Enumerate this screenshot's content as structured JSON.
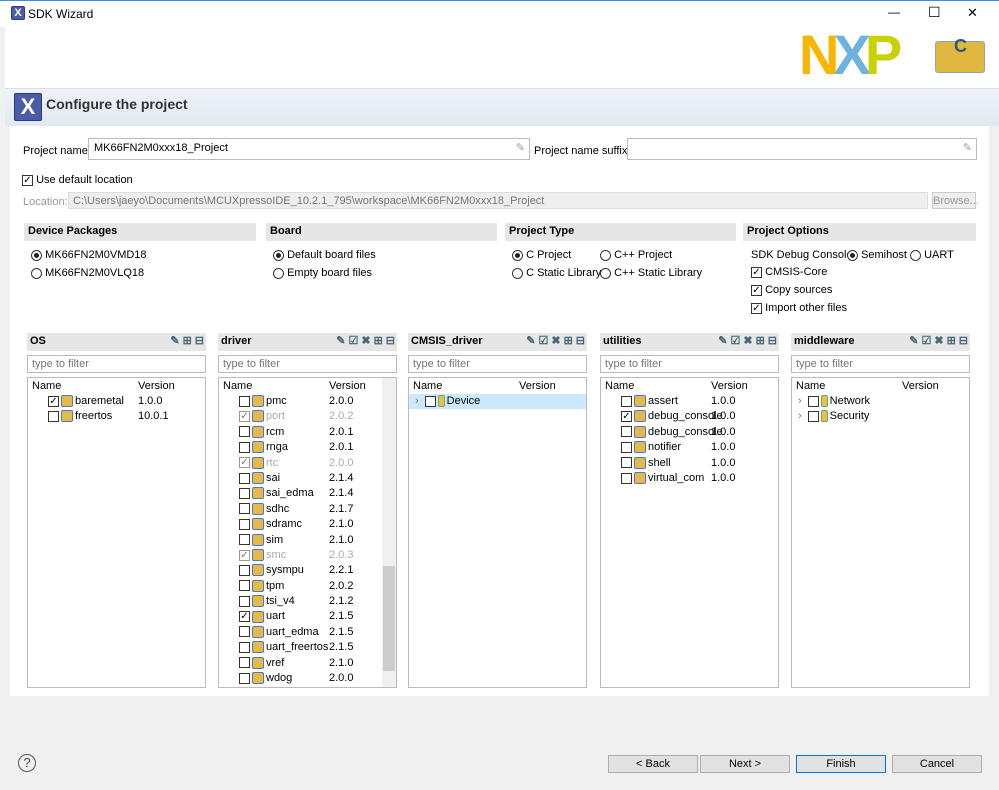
{
  "window": {
    "title": "SDK Wizard",
    "minimize": "—",
    "maximize": "☐",
    "close": "✕"
  },
  "banner": {
    "heading": "Configure the project",
    "logo": "NXP"
  },
  "project": {
    "name_label": "Project name:",
    "name_value": "MK66FN2M0xxx18_Project",
    "suffix_label": "Project name suffix:",
    "suffix_value": "",
    "use_default_label": "Use default location",
    "use_default_checked": true,
    "location_label": "Location:",
    "location_value": "C:\\Users\\jaeyo\\Documents\\MCUXpressoIDE_10.2.1_795\\workspace\\MK66FN2M0xxx18_Project",
    "browse_label": "Browse..."
  },
  "device_packages": {
    "title": "Device Packages",
    "options": [
      {
        "label": "MK66FN2M0VMD18",
        "selected": true
      },
      {
        "label": "MK66FN2M0VLQ18",
        "selected": false
      }
    ]
  },
  "board": {
    "title": "Board",
    "options": [
      {
        "label": "Default board files",
        "selected": true
      },
      {
        "label": "Empty board files",
        "selected": false
      }
    ]
  },
  "project_type": {
    "title": "Project Type",
    "options": [
      {
        "label": "C Project",
        "selected": true
      },
      {
        "label": "C++ Project",
        "selected": false
      },
      {
        "label": "C Static Library",
        "selected": false
      },
      {
        "label": "C++ Static Library",
        "selected": false
      }
    ]
  },
  "project_options": {
    "title": "Project Options",
    "debug_console_label": "SDK Debug Console",
    "semihost": "Semihost",
    "uart": "UART",
    "semihost_selected": true,
    "checks": [
      {
        "label": "CMSIS-Core",
        "checked": true
      },
      {
        "label": "Copy sources",
        "checked": true
      },
      {
        "label": "Import other files",
        "checked": true
      }
    ]
  },
  "panels": [
    {
      "title": "OS",
      "filter_placeholder": "type to filter",
      "col_name": "Name",
      "col_version": "Version",
      "items": [
        {
          "name": "baremetal",
          "version": "1.0.0",
          "checked": true
        },
        {
          "name": "freertos",
          "version": "10.0.1",
          "checked": false
        }
      ]
    },
    {
      "title": "driver",
      "filter_placeholder": "type to filter",
      "col_name": "Name",
      "col_version": "Version",
      "items": [
        {
          "name": "pmc",
          "version": "2.0.0",
          "checked": false
        },
        {
          "name": "port",
          "version": "2.0.2",
          "checked": true,
          "dim": true
        },
        {
          "name": "rcm",
          "version": "2.0.1",
          "checked": false
        },
        {
          "name": "rnga",
          "version": "2.0.1",
          "checked": false
        },
        {
          "name": "rtc",
          "version": "2.0.0",
          "checked": true,
          "dim": true
        },
        {
          "name": "sai",
          "version": "2.1.4",
          "checked": false
        },
        {
          "name": "sai_edma",
          "version": "2.1.4",
          "checked": false
        },
        {
          "name": "sdhc",
          "version": "2.1.7",
          "checked": false
        },
        {
          "name": "sdramc",
          "version": "2.1.0",
          "checked": false
        },
        {
          "name": "sim",
          "version": "2.1.0",
          "checked": false
        },
        {
          "name": "smc",
          "version": "2.0.3",
          "checked": true,
          "dim": true
        },
        {
          "name": "sysmpu",
          "version": "2.2.1",
          "checked": false
        },
        {
          "name": "tpm",
          "version": "2.0.2",
          "checked": false
        },
        {
          "name": "tsi_v4",
          "version": "2.1.2",
          "checked": false
        },
        {
          "name": "uart",
          "version": "2.1.5",
          "checked": true
        },
        {
          "name": "uart_edma",
          "version": "2.1.5",
          "checked": false
        },
        {
          "name": "uart_freertos",
          "version": "2.1.5",
          "checked": false
        },
        {
          "name": "vref",
          "version": "2.1.0",
          "checked": false
        },
        {
          "name": "wdog",
          "version": "2.0.0",
          "checked": false
        }
      ]
    },
    {
      "title": "CMSIS_driver",
      "filter_placeholder": "type to filter",
      "col_name": "Name",
      "col_version": "Version",
      "items": [
        {
          "name": "Device",
          "version": "",
          "checked": false,
          "expandable": true,
          "selected": true
        }
      ]
    },
    {
      "title": "utilities",
      "filter_placeholder": "type to filter",
      "col_name": "Name",
      "col_version": "Version",
      "items": [
        {
          "name": "assert",
          "version": "1.0.0",
          "checked": false
        },
        {
          "name": "debug_console",
          "version": "1.0.0",
          "checked": true
        },
        {
          "name": "debug_console",
          "version": "1.0.0",
          "checked": false
        },
        {
          "name": "notifier",
          "version": "1.0.0",
          "checked": false
        },
        {
          "name": "shell",
          "version": "1.0.0",
          "checked": false
        },
        {
          "name": "virtual_com",
          "version": "1.0.0",
          "checked": false
        }
      ]
    },
    {
      "title": "middleware",
      "filter_placeholder": "type to filter",
      "col_name": "Name",
      "col_version": "Version",
      "items": [
        {
          "name": "Network",
          "version": "",
          "checked": false,
          "expandable": true
        },
        {
          "name": "Security",
          "version": "",
          "checked": false,
          "expandable": true
        }
      ]
    }
  ],
  "footer": {
    "help": "?",
    "back": "< Back",
    "next": "Next >",
    "finish": "Finish",
    "cancel": "Cancel"
  }
}
